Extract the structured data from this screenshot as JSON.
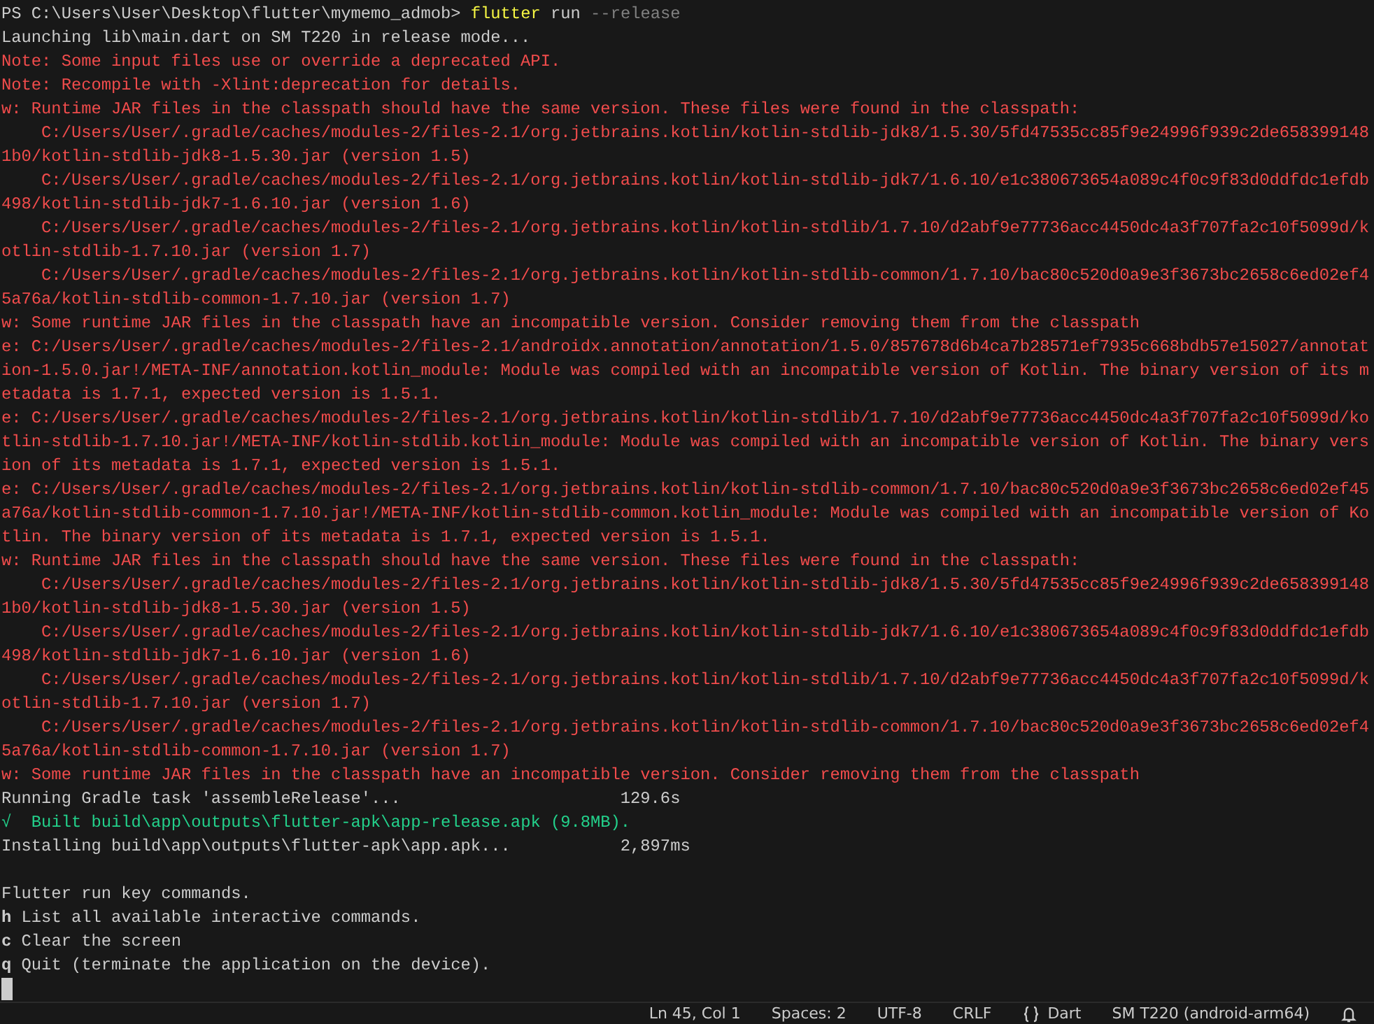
{
  "terminal": {
    "lines": [
      {
        "kind": "prompt",
        "prompt": "PS C:\\Users\\User\\Desktop\\flutter\\mymemo_admob>",
        "command": "flutter",
        "args": "run",
        "flags": "--release"
      },
      {
        "kind": "plain",
        "text": "Launching lib\\main.dart on SM T220 in release mode..."
      },
      {
        "kind": "error",
        "text": "Note: Some input files use or override a deprecated API."
      },
      {
        "kind": "error",
        "text": "Note: Recompile with -Xlint:deprecation for details."
      },
      {
        "kind": "error",
        "text": "w: Runtime JAR files in the classpath should have the same version. These files were found in the classpath:"
      },
      {
        "kind": "error",
        "text": "    C:/Users/User/.gradle/caches/modules-2/files-2.1/org.jetbrains.kotlin/kotlin-stdlib-jdk8/1.5.30/5fd47535cc85f9e24996f939c2de658399148"
      },
      {
        "kind": "error",
        "text": "1b0/kotlin-stdlib-jdk8-1.5.30.jar (version 1.5)"
      },
      {
        "kind": "error",
        "text": "    C:/Users/User/.gradle/caches/modules-2/files-2.1/org.jetbrains.kotlin/kotlin-stdlib-jdk7/1.6.10/e1c380673654a089c4f0c9f83d0ddfdc1efdb"
      },
      {
        "kind": "error",
        "text": "498/kotlin-stdlib-jdk7-1.6.10.jar (version 1.6)"
      },
      {
        "kind": "error",
        "text": "    C:/Users/User/.gradle/caches/modules-2/files-2.1/org.jetbrains.kotlin/kotlin-stdlib/1.7.10/d2abf9e77736acc4450dc4a3f707fa2c10f5099d/k"
      },
      {
        "kind": "error",
        "text": "otlin-stdlib-1.7.10.jar (version 1.7)"
      },
      {
        "kind": "error",
        "text": "    C:/Users/User/.gradle/caches/modules-2/files-2.1/org.jetbrains.kotlin/kotlin-stdlib-common/1.7.10/bac80c520d0a9e3f3673bc2658c6ed02ef4"
      },
      {
        "kind": "error",
        "text": "5a76a/kotlin-stdlib-common-1.7.10.jar (version 1.7)"
      },
      {
        "kind": "error",
        "text": "w: Some runtime JAR files in the classpath have an incompatible version. Consider removing them from the classpath"
      },
      {
        "kind": "error",
        "text": "e: C:/Users/User/.gradle/caches/modules-2/files-2.1/androidx.annotation/annotation/1.5.0/857678d6b4ca7b28571ef7935c668bdb57e15027/annotat"
      },
      {
        "kind": "error",
        "text": "ion-1.5.0.jar!/META-INF/annotation.kotlin_module: Module was compiled with an incompatible version of Kotlin. The binary version of its m"
      },
      {
        "kind": "error",
        "text": "etadata is 1.7.1, expected version is 1.5.1."
      },
      {
        "kind": "error",
        "text": "e: C:/Users/User/.gradle/caches/modules-2/files-2.1/org.jetbrains.kotlin/kotlin-stdlib/1.7.10/d2abf9e77736acc4450dc4a3f707fa2c10f5099d/ko"
      },
      {
        "kind": "error",
        "text": "tlin-stdlib-1.7.10.jar!/META-INF/kotlin-stdlib.kotlin_module: Module was compiled with an incompatible version of Kotlin. The binary vers"
      },
      {
        "kind": "error",
        "text": "ion of its metadata is 1.7.1, expected version is 1.5.1."
      },
      {
        "kind": "error",
        "text": "e: C:/Users/User/.gradle/caches/modules-2/files-2.1/org.jetbrains.kotlin/kotlin-stdlib-common/1.7.10/bac80c520d0a9e3f3673bc2658c6ed02ef45"
      },
      {
        "kind": "error",
        "text": "a76a/kotlin-stdlib-common-1.7.10.jar!/META-INF/kotlin-stdlib-common.kotlin_module: Module was compiled with an incompatible version of Ko"
      },
      {
        "kind": "error",
        "text": "tlin. The binary version of its metadata is 1.7.1, expected version is 1.5.1."
      },
      {
        "kind": "error",
        "text": "w: Runtime JAR files in the classpath should have the same version. These files were found in the classpath:"
      },
      {
        "kind": "error",
        "text": "    C:/Users/User/.gradle/caches/modules-2/files-2.1/org.jetbrains.kotlin/kotlin-stdlib-jdk8/1.5.30/5fd47535cc85f9e24996f939c2de658399148"
      },
      {
        "kind": "error",
        "text": "1b0/kotlin-stdlib-jdk8-1.5.30.jar (version 1.5)"
      },
      {
        "kind": "error",
        "text": "    C:/Users/User/.gradle/caches/modules-2/files-2.1/org.jetbrains.kotlin/kotlin-stdlib-jdk7/1.6.10/e1c380673654a089c4f0c9f83d0ddfdc1efdb"
      },
      {
        "kind": "error",
        "text": "498/kotlin-stdlib-jdk7-1.6.10.jar (version 1.6)"
      },
      {
        "kind": "error",
        "text": "    C:/Users/User/.gradle/caches/modules-2/files-2.1/org.jetbrains.kotlin/kotlin-stdlib/1.7.10/d2abf9e77736acc4450dc4a3f707fa2c10f5099d/k"
      },
      {
        "kind": "error",
        "text": "otlin-stdlib-1.7.10.jar (version 1.7)"
      },
      {
        "kind": "error",
        "text": "    C:/Users/User/.gradle/caches/modules-2/files-2.1/org.jetbrains.kotlin/kotlin-stdlib-common/1.7.10/bac80c520d0a9e3f3673bc2658c6ed02ef4"
      },
      {
        "kind": "error",
        "text": "5a76a/kotlin-stdlib-common-1.7.10.jar (version 1.7)"
      },
      {
        "kind": "error",
        "text": "w: Some runtime JAR files in the classpath have an incompatible version. Consider removing them from the classpath"
      },
      {
        "kind": "timed",
        "text": "Running Gradle task 'assembleRelease'...",
        "time": "129.6s"
      },
      {
        "kind": "success",
        "mark": "√",
        "text": "Built build\\app\\outputs\\flutter-apk\\app-release.apk (9.8MB)."
      },
      {
        "kind": "timed",
        "text": "Installing build\\app\\outputs\\flutter-apk\\app.apk...",
        "time": "2,897ms"
      },
      {
        "kind": "blank"
      },
      {
        "kind": "plain",
        "text": "Flutter run key commands."
      },
      {
        "kind": "key",
        "key": "h",
        "text": "List all available interactive commands."
      },
      {
        "kind": "key",
        "key": "c",
        "text": "Clear the screen"
      },
      {
        "kind": "key",
        "key": "q",
        "text": "Quit (terminate the application on the device)."
      },
      {
        "kind": "cursor"
      }
    ]
  },
  "status_bar": {
    "items": [
      "Ln 45, Col 1",
      "Spaces: 2",
      "UTF-8",
      "CRLF",
      "Dart",
      "SM T220 (android-arm64)"
    ]
  }
}
